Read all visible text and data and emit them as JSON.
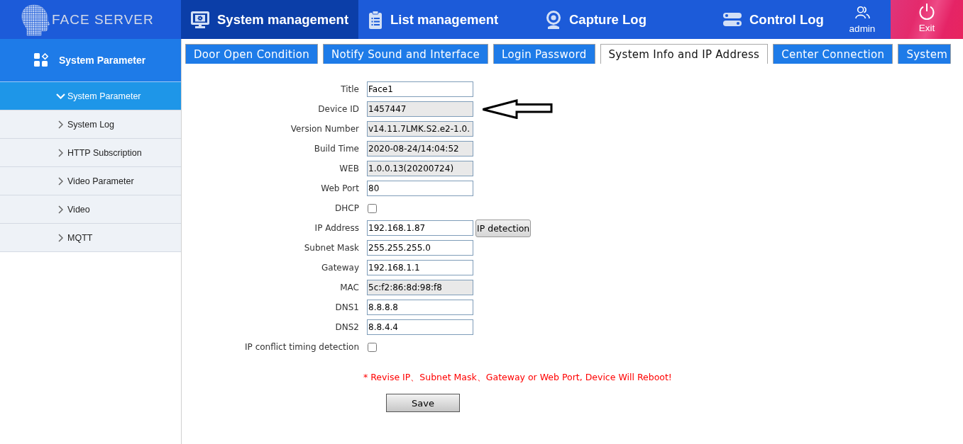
{
  "logo": {
    "text": "FACE SERVER"
  },
  "nav": [
    {
      "label": "System management",
      "selected": true
    },
    {
      "label": "List management",
      "selected": false
    },
    {
      "label": "Capture Log",
      "selected": false
    },
    {
      "label": "Control Log",
      "selected": false
    }
  ],
  "user": {
    "label": "admin"
  },
  "exit": {
    "label": "Exit"
  },
  "sidebar": {
    "title": "System Parameter",
    "items": [
      {
        "label": "System Parameter",
        "selected": true,
        "expanded": true
      },
      {
        "label": "System Log",
        "selected": false,
        "expanded": false
      },
      {
        "label": "HTTP Subscription",
        "selected": false,
        "expanded": false
      },
      {
        "label": "Video Parameter",
        "selected": false,
        "expanded": false
      },
      {
        "label": "Video",
        "selected": false,
        "expanded": false
      },
      {
        "label": "MQTT",
        "selected": false,
        "expanded": false
      }
    ]
  },
  "tabs": [
    {
      "label": "Door Open Condition",
      "selected": false
    },
    {
      "label": "Notify Sound and Interface",
      "selected": false
    },
    {
      "label": "Login Password",
      "selected": false
    },
    {
      "label": "System Info and IP Address",
      "selected": true
    },
    {
      "label": "Center Connection",
      "selected": false
    },
    {
      "label": "System",
      "selected": false
    }
  ],
  "form": {
    "fields": [
      {
        "label": "Title",
        "kind": "text",
        "value": "Face1",
        "readonly": false,
        "arrow": false
      },
      {
        "label": "Device ID",
        "kind": "text",
        "value": "1457447",
        "readonly": true,
        "arrow": true
      },
      {
        "label": "Version Number",
        "kind": "text",
        "value": "v14.11.7LMK.S2.e2-1.0.",
        "readonly": true,
        "arrow": false
      },
      {
        "label": "Build Time",
        "kind": "text",
        "value": "2020-08-24/14:04:52",
        "readonly": true,
        "arrow": false
      },
      {
        "label": "WEB",
        "kind": "text",
        "value": "1.0.0.13(20200724)",
        "readonly": true,
        "arrow": false
      },
      {
        "label": "Web Port",
        "kind": "text",
        "value": "80",
        "readonly": false,
        "arrow": false
      },
      {
        "label": "DHCP",
        "kind": "checkbox",
        "checked": false,
        "arrow": false
      },
      {
        "label": "IP Address",
        "kind": "text",
        "value": "192.168.1.87",
        "readonly": false,
        "arrow": false,
        "button": "IP detection"
      },
      {
        "label": "Subnet Mask",
        "kind": "text",
        "value": "255.255.255.0",
        "readonly": false,
        "arrow": false
      },
      {
        "label": "Gateway",
        "kind": "text",
        "value": "192.168.1.1",
        "readonly": false,
        "arrow": false
      },
      {
        "label": "MAC",
        "kind": "text",
        "value": "5c:f2:86:8d:98:f8",
        "readonly": true,
        "arrow": false
      },
      {
        "label": "DNS1",
        "kind": "text",
        "value": "8.8.8.8",
        "readonly": false,
        "arrow": false
      },
      {
        "label": "DNS2",
        "kind": "text",
        "value": "8.8.4.4",
        "readonly": false,
        "arrow": false
      },
      {
        "label": "IP conflict timing detection",
        "kind": "checkbox",
        "checked": false,
        "arrow": false
      }
    ],
    "warning": "* Revise IP、Subnet Mask、Gateway or Web Port, Device Will Reboot!",
    "save_button": "Save"
  }
}
